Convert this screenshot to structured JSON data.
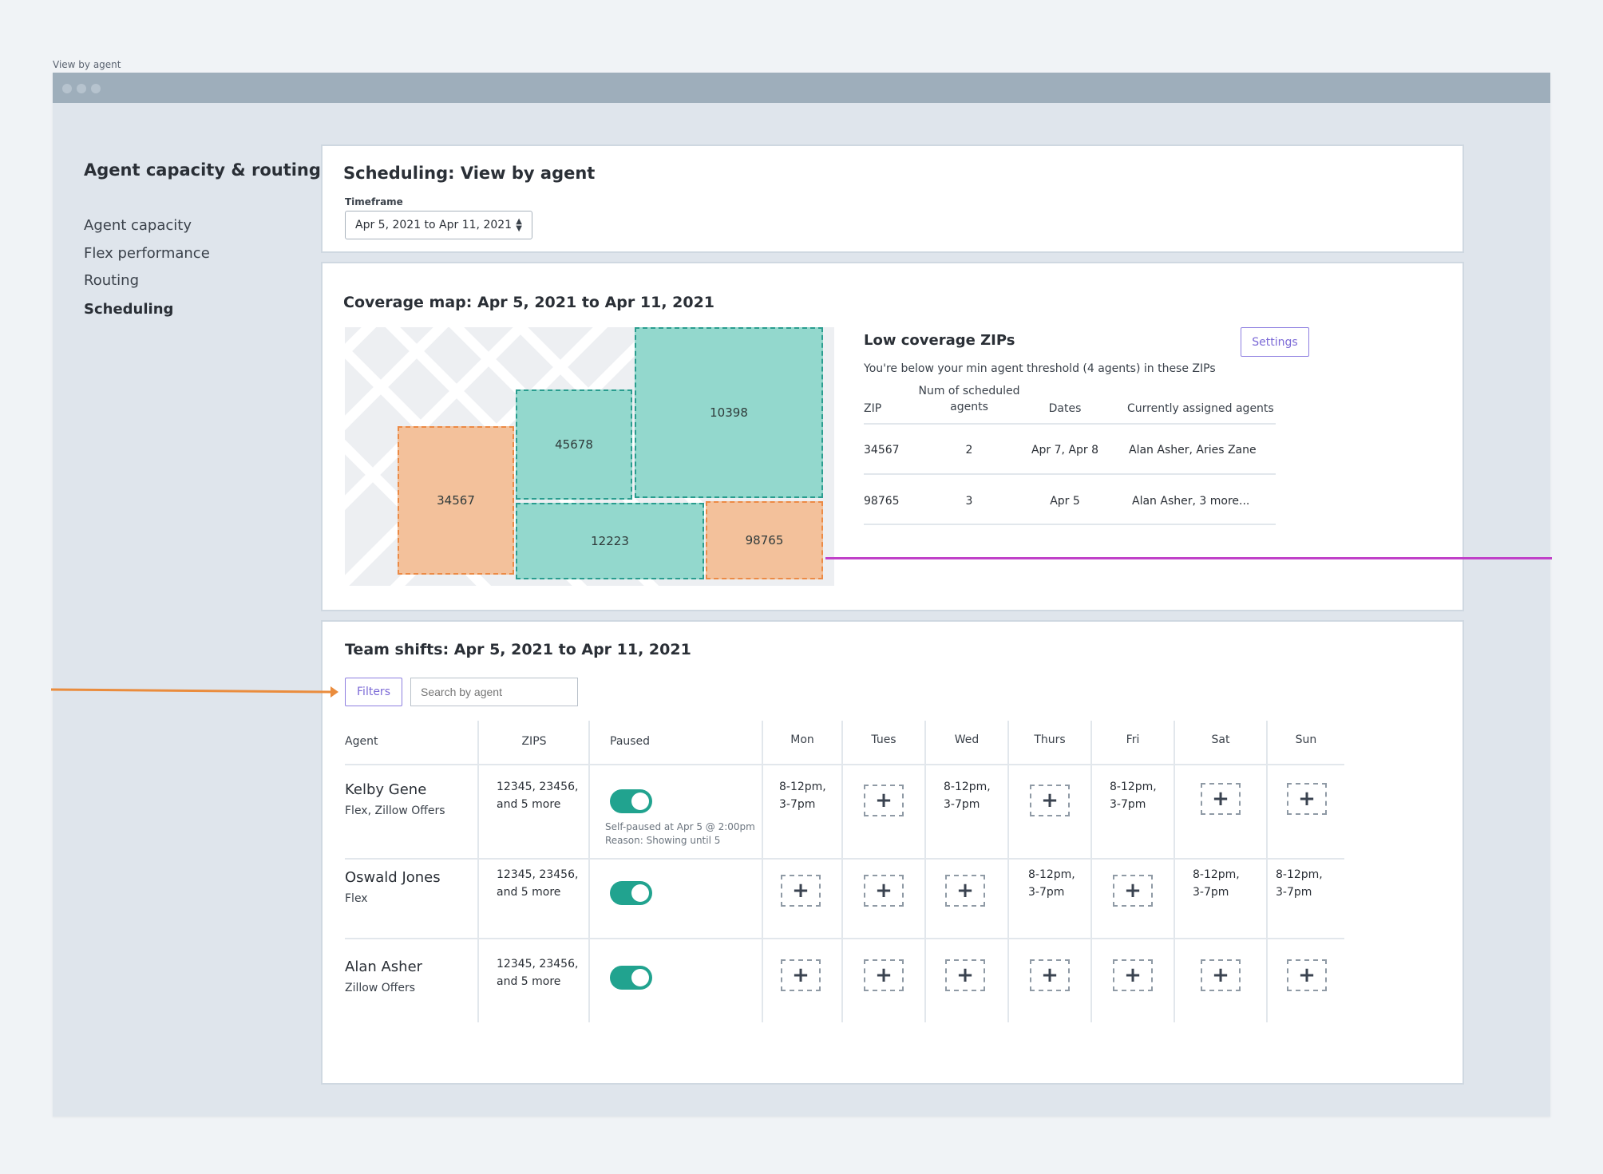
{
  "frame_label": "View by agent",
  "nav": {
    "title": "Agent capacity & routing",
    "items": [
      {
        "label": "Agent capacity",
        "active": false
      },
      {
        "label": "Flex performance",
        "active": false
      },
      {
        "label": "Routing",
        "active": false
      },
      {
        "label": "Scheduling",
        "active": true
      }
    ]
  },
  "header": {
    "title": "Scheduling: View by agent",
    "timeframe_label": "Timeframe",
    "timeframe_value": "Apr 5, 2021 to Apr 11, 2021"
  },
  "coverage": {
    "title": "Coverage map: Apr 5, 2021 to Apr 11, 2021",
    "zips": [
      {
        "zip": "34567",
        "status": "low"
      },
      {
        "zip": "45678",
        "status": "ok"
      },
      {
        "zip": "10398",
        "status": "ok"
      },
      {
        "zip": "12223",
        "status": "ok"
      },
      {
        "zip": "98765",
        "status": "low"
      }
    ],
    "low_coverage": {
      "title": "Low coverage ZIPs",
      "settings_label": "Settings",
      "subtitle": "You're below your min agent threshold (4 agents) in these ZIPs",
      "columns": {
        "zip": "ZIP",
        "num_line1": "Num of scheduled",
        "num_line2": "agents",
        "dates": "Dates",
        "agents": "Currently assigned agents"
      },
      "rows": [
        {
          "zip": "34567",
          "num": "2",
          "dates": "Apr 7, Apr 8",
          "agents": "Alan Asher, Aries Zane"
        },
        {
          "zip": "98765",
          "num": "3",
          "dates": "Apr 5",
          "agents": "Alan Asher, 3 more..."
        }
      ]
    }
  },
  "shifts": {
    "title": "Team shifts: Apr 5, 2021 to Apr 11, 2021",
    "filters_label": "Filters",
    "search_placeholder": "Search by agent",
    "columns": {
      "agent": "Agent",
      "zips": "ZIPS",
      "paused": "Paused",
      "mon": "Mon",
      "tue": "Tues",
      "wed": "Wed",
      "thu": "Thurs",
      "fri": "Fri",
      "sat": "Sat",
      "sun": "Sun"
    },
    "rows": [
      {
        "name": "Kelby Gene",
        "type": "Flex, Zillow Offers",
        "zips_line1": "12345, 23456,",
        "zips_line2": "and 5 more",
        "paused_note1": "Self-paused at Apr 5 @ 2:00pm",
        "paused_note2": "Reason: Showing until 5",
        "mon_1": "8-12pm,",
        "mon_2": "3-7pm",
        "wed_1": "8-12pm,",
        "wed_2": "3-7pm",
        "fri_1": "8-12pm,",
        "fri_2": "3-7pm"
      },
      {
        "name": "Oswald Jones",
        "type": "Flex",
        "zips_line1": "12345, 23456,",
        "zips_line2": "and 5 more",
        "thu_1": "8-12pm,",
        "thu_2": "3-7pm",
        "sat_1": "8-12pm,",
        "sat_2": "3-7pm",
        "sun_1": "8-12pm,",
        "sun_2": "3-7pm"
      },
      {
        "name": "Alan Asher",
        "type": "Zillow Offers",
        "zips_line1": "12345, 23456,",
        "zips_line2": "and 5 more"
      }
    ],
    "add_icon": "plus-icon"
  },
  "colors": {
    "accent_purple": "#7b69d6",
    "low_zip": "#f3c19b",
    "ok_zip": "#93d8cd",
    "toggle_on": "#21a38f",
    "annotation_orange": "#ea8c3d",
    "annotation_magenta": "#c040c8"
  }
}
